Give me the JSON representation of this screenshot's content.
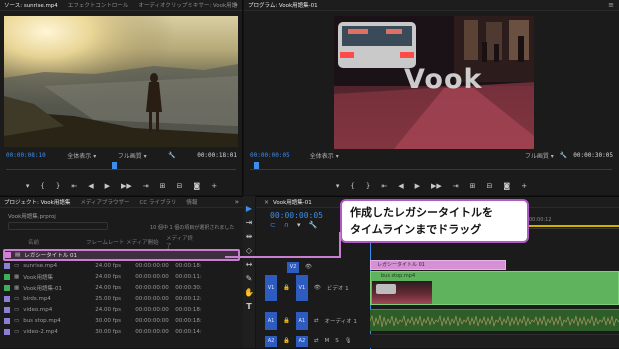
{
  "source_monitor": {
    "tabs": [
      "ソース: sunrise.mp4",
      "エフェクトコントロール",
      "オーディオクリップミキサー: Vook用語"
    ],
    "timecode": "00:00:08:10",
    "fit": "全体表示",
    "quality": "フル画質",
    "duration": "00:00:18:01"
  },
  "program_monitor": {
    "tab": "プログラム: Vook用語集-01",
    "timecode": "00:00:00:05",
    "fit": "全体表示",
    "quality": "フル画質",
    "duration": "00:00:30:05",
    "overlay_text": "Vook"
  },
  "transport": {
    "buttons": [
      "▾",
      "{",
      "}",
      "⇤",
      "◀",
      "▶",
      "▶▶",
      "⇥",
      "⊞",
      "⊟",
      "◙",
      "+"
    ]
  },
  "project": {
    "tabs": [
      "プロジェクト: Vook用語集",
      "メディアブラウザー",
      "CC ライブラリ",
      "情報"
    ],
    "file": "Vook用語集.prproj",
    "selection": "10 個中 1 個の項目が選択されました",
    "columns": [
      "名前",
      "フレームレート",
      "メディア開始",
      "メディア終了"
    ],
    "items": [
      {
        "name": "レガシータイトル 01",
        "fps": "",
        "start": "",
        "end": "",
        "color": "#d77fd6"
      },
      {
        "name": "sunrise.mp4",
        "fps": "24.00 fps",
        "start": "00:00:00:00",
        "end": "00:00:18:",
        "color": "#8c7fd6"
      },
      {
        "name": "Vook用語集",
        "fps": "24.00 fps",
        "start": "00:00:00:00",
        "end": "00:00:11:",
        "color": "#3fae57"
      },
      {
        "name": "Vook用語集-01",
        "fps": "24.00 fps",
        "start": "00:00:00:00",
        "end": "00:00:30:",
        "color": "#3fae57"
      },
      {
        "name": "birds.mp4",
        "fps": "25.00 fps",
        "start": "00:00:00:00",
        "end": "00:00:12:",
        "color": "#8c7fd6"
      },
      {
        "name": "video.mp4",
        "fps": "24.00 fps",
        "start": "00:00:00:00",
        "end": "00:00:18:",
        "color": "#8c7fd6"
      },
      {
        "name": "bus stop.mp4",
        "fps": "30.00 fps",
        "start": "00:00:00:00",
        "end": "00:00:18:",
        "color": "#8c7fd6"
      },
      {
        "name": "video-2.mp4",
        "fps": "30.00 fps",
        "start": "00:00:00:00",
        "end": "00:00:14:",
        "color": "#8c7fd6"
      }
    ]
  },
  "timeline": {
    "tab": "Vook用語集-01",
    "timecode": "00:00:00:05",
    "ruler": "00:00:12",
    "tracks": {
      "v2": "V2",
      "v1_left": "V1",
      "v1": "V1",
      "v1_name": "ビデオ 1",
      "a1_left": "A1",
      "a1": "A1",
      "a1_name": "オーディオ 1",
      "a2_left": "A2",
      "a2": "A2"
    },
    "clips": {
      "title_clip": "レガシータイトル 01",
      "video_clip": "bus stop.mp4"
    }
  },
  "callout": {
    "line1": "作成したレガシータイトルを",
    "line2": "タイムラインまでドラッグ"
  },
  "colors": {
    "accent": "#3d8eea",
    "title_clip": "#d590d6",
    "video_clip": "#5fb35c",
    "audio_clip": "#2d5e2a",
    "callout_border": "#b05ac8"
  }
}
